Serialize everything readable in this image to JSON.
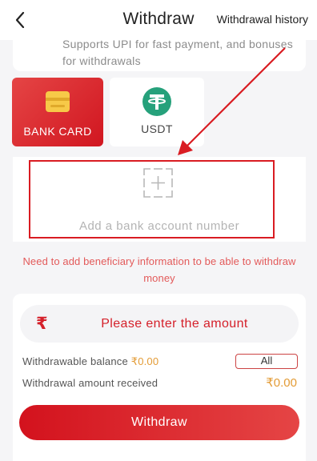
{
  "header": {
    "title": "Withdraw",
    "history_link": "Withdrawal history"
  },
  "notice": {
    "line1": "Supports UPI for fast payment, and bonuses",
    "line2": "for withdrawals"
  },
  "methods": [
    {
      "label": "BANK CARD",
      "icon": "card-icon",
      "selected": true
    },
    {
      "label": "USDT",
      "icon": "tether-icon",
      "selected": false
    }
  ],
  "add_bank": {
    "label": "Add a bank account number"
  },
  "warning": "Need to add beneficiary information to be able to withdraw money",
  "amount": {
    "currency_symbol": "₹",
    "placeholder": "Please enter the amount",
    "value": ""
  },
  "balance": {
    "label": "Withdrawable balance",
    "value": "₹0.00",
    "all_label": "All"
  },
  "received": {
    "label": "Withdrawal amount received",
    "value": "₹0.00"
  },
  "withdraw_button": "Withdraw",
  "colors": {
    "accent": "#d5202a",
    "amount_value": "#e39b35",
    "warning": "#e35a5a",
    "usdt_green": "#26a17b"
  }
}
